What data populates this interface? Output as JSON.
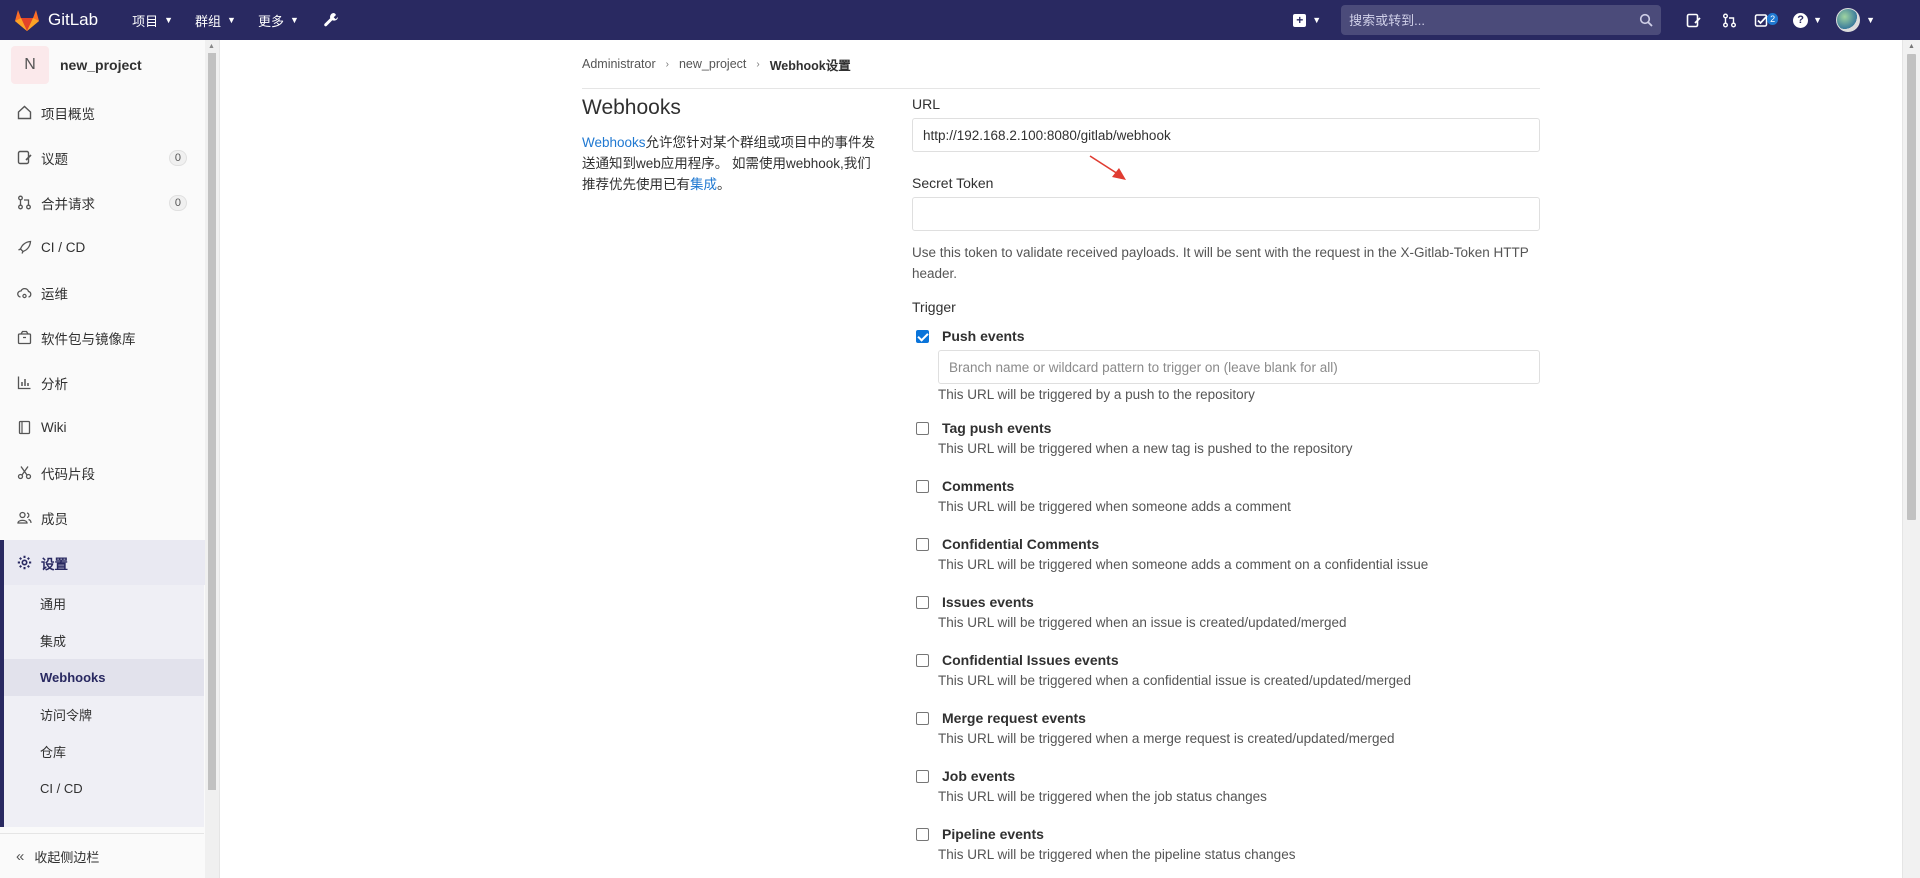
{
  "navbar": {
    "brand": "GitLab",
    "menu": [
      {
        "label": "项目"
      },
      {
        "label": "群组"
      },
      {
        "label": "更多"
      }
    ],
    "search_placeholder": "搜索或转到...",
    "todo_count": "2"
  },
  "sidebar": {
    "project_initial": "N",
    "project_name": "new_project",
    "items": [
      {
        "label": "项目概览",
        "icon": "home-icon"
      },
      {
        "label": "议题",
        "icon": "issues-icon",
        "count": "0"
      },
      {
        "label": "合并请求",
        "icon": "merge-request-icon",
        "count": "0"
      },
      {
        "label": "CI / CD",
        "icon": "rocket-icon"
      },
      {
        "label": "运维",
        "icon": "cloud-gear-icon"
      },
      {
        "label": "软件包与镜像库",
        "icon": "package-icon"
      },
      {
        "label": "分析",
        "icon": "chart-icon"
      },
      {
        "label": "Wiki",
        "icon": "book-icon"
      },
      {
        "label": "代码片段",
        "icon": "scissors-icon"
      },
      {
        "label": "成员",
        "icon": "users-icon"
      }
    ],
    "settings": {
      "label": "设置",
      "subitems": [
        "通用",
        "集成",
        "Webhooks",
        "访问令牌",
        "仓库",
        "CI / CD"
      ],
      "active": "Webhooks"
    },
    "collapse_label": "收起侧边栏"
  },
  "breadcrumb": [
    "Administrator",
    "new_project",
    "Webhook设置"
  ],
  "left": {
    "title": "Webhooks",
    "desc_link": "Webhooks",
    "desc_text1": "允许您针对某个群组或项目中的事件发送通知到web应用程序。 如需使用webhook,我们推荐优先使用已有",
    "desc_link2": "集成",
    "desc_text2": "。"
  },
  "form": {
    "url_label": "URL",
    "url_value": "http://192.168.2.100:8080/gitlab/webhook",
    "token_label": "Secret Token",
    "token_value": "",
    "token_help": "Use this token to validate received payloads. It will be sent with the request in the X-Gitlab-Token HTTP header.",
    "trigger_label": "Trigger",
    "branch_placeholder": "Branch name or wildcard pattern to trigger on (leave blank for all)",
    "triggers": [
      {
        "title": "Push events",
        "help": "This URL will be triggered by a push to the repository",
        "checked": true
      },
      {
        "title": "Tag push events",
        "help": "This URL will be triggered when a new tag is pushed to the repository",
        "checked": false
      },
      {
        "title": "Comments",
        "help": "This URL will be triggered when someone adds a comment",
        "checked": false
      },
      {
        "title": "Confidential Comments",
        "help": "This URL will be triggered when someone adds a comment on a confidential issue",
        "checked": false
      },
      {
        "title": "Issues events",
        "help": "This URL will be triggered when an issue is created/updated/merged",
        "checked": false
      },
      {
        "title": "Confidential Issues events",
        "help": "This URL will be triggered when a confidential issue is created/updated/merged",
        "checked": false
      },
      {
        "title": "Merge request events",
        "help": "This URL will be triggered when a merge request is created/updated/merged",
        "checked": false
      },
      {
        "title": "Job events",
        "help": "This URL will be triggered when the job status changes",
        "checked": false
      },
      {
        "title": "Pipeline events",
        "help": "This URL will be triggered when the pipeline status changes",
        "checked": false
      }
    ]
  },
  "colors": {
    "navbar": "#292961",
    "link": "#1f78d1",
    "checkbox": "#0a74da",
    "arrow": "#e03c31"
  }
}
